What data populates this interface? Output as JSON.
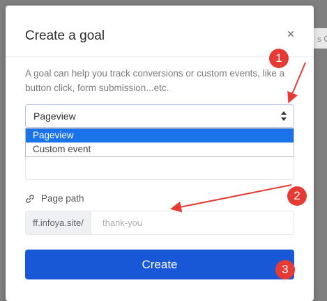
{
  "background": {
    "fragment_text": "s Ou"
  },
  "modal": {
    "title": "Create a goal",
    "close_glyph": "×",
    "description": "A goal can help you track conversions or custom events, like a button click, form submission...etc.",
    "goal_type": {
      "selected": "Pageview",
      "options": [
        "Pageview",
        "Custom event"
      ]
    },
    "page_path": {
      "label": "Page path",
      "prefix": "ff.infoya.site/",
      "placeholder": "thank-you",
      "value": ""
    },
    "create_label": "Create"
  },
  "annotations": {
    "badges": [
      "1",
      "2",
      "3"
    ],
    "color": "#e63a35"
  },
  "colors": {
    "primary": "#1858d6",
    "selected_option": "#1a73e8"
  },
  "icons": [
    "close-icon",
    "select-arrows-icon",
    "link-icon"
  ]
}
